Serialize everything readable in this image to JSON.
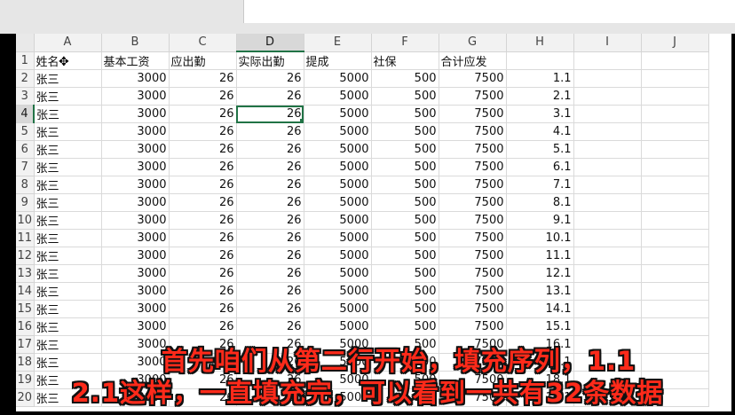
{
  "columns": [
    "A",
    "B",
    "C",
    "D",
    "E",
    "F",
    "G",
    "H",
    "I",
    "J"
  ],
  "selected_column": "D",
  "selected_row": "4",
  "header_row": {
    "row": "1",
    "cells": [
      "姓名",
      "基本工资",
      "应出勤",
      "实际出勤",
      "提成",
      "社保",
      "合计应发",
      "",
      "",
      ""
    ]
  },
  "data_rows": [
    {
      "row": "2",
      "cells": [
        "张三",
        "3000",
        "26",
        "26",
        "5000",
        "500",
        "7500",
        "1.1",
        "",
        ""
      ]
    },
    {
      "row": "3",
      "cells": [
        "张三",
        "3000",
        "26",
        "26",
        "5000",
        "500",
        "7500",
        "2.1",
        "",
        ""
      ]
    },
    {
      "row": "4",
      "cells": [
        "张三",
        "3000",
        "26",
        "26",
        "5000",
        "500",
        "7500",
        "3.1",
        "",
        ""
      ]
    },
    {
      "row": "5",
      "cells": [
        "张三",
        "3000",
        "26",
        "26",
        "5000",
        "500",
        "7500",
        "4.1",
        "",
        ""
      ]
    },
    {
      "row": "6",
      "cells": [
        "张三",
        "3000",
        "26",
        "26",
        "5000",
        "500",
        "7500",
        "5.1",
        "",
        ""
      ]
    },
    {
      "row": "7",
      "cells": [
        "张三",
        "3000",
        "26",
        "26",
        "5000",
        "500",
        "7500",
        "6.1",
        "",
        ""
      ]
    },
    {
      "row": "8",
      "cells": [
        "张三",
        "3000",
        "26",
        "26",
        "5000",
        "500",
        "7500",
        "7.1",
        "",
        ""
      ]
    },
    {
      "row": "9",
      "cells": [
        "张三",
        "3000",
        "26",
        "26",
        "5000",
        "500",
        "7500",
        "8.1",
        "",
        ""
      ]
    },
    {
      "row": "10",
      "cells": [
        "张三",
        "3000",
        "26",
        "26",
        "5000",
        "500",
        "7500",
        "9.1",
        "",
        ""
      ]
    },
    {
      "row": "11",
      "cells": [
        "张三",
        "3000",
        "26",
        "26",
        "5000",
        "500",
        "7500",
        "10.1",
        "",
        ""
      ]
    },
    {
      "row": "12",
      "cells": [
        "张三",
        "3000",
        "26",
        "26",
        "5000",
        "500",
        "7500",
        "11.1",
        "",
        ""
      ]
    },
    {
      "row": "13",
      "cells": [
        "张三",
        "3000",
        "26",
        "26",
        "5000",
        "500",
        "7500",
        "12.1",
        "",
        ""
      ]
    },
    {
      "row": "14",
      "cells": [
        "张三",
        "3000",
        "26",
        "26",
        "5000",
        "500",
        "7500",
        "13.1",
        "",
        ""
      ]
    },
    {
      "row": "15",
      "cells": [
        "张三",
        "3000",
        "26",
        "26",
        "5000",
        "500",
        "7500",
        "14.1",
        "",
        ""
      ]
    },
    {
      "row": "16",
      "cells": [
        "张三",
        "3000",
        "26",
        "26",
        "5000",
        "500",
        "7500",
        "15.1",
        "",
        ""
      ]
    },
    {
      "row": "17",
      "cells": [
        "张三",
        "3000",
        "26",
        "26",
        "5000",
        "500",
        "7500",
        "16.1",
        "",
        ""
      ]
    },
    {
      "row": "18",
      "cells": [
        "张三",
        "3000",
        "26",
        "26",
        "5000",
        "500",
        "7500",
        "17.1",
        "",
        ""
      ]
    },
    {
      "row": "19",
      "cells": [
        "张三",
        "3000",
        "26",
        "26",
        "5000",
        "500",
        "7500",
        "18.1",
        "",
        ""
      ]
    },
    {
      "row": "20",
      "cells": [
        "张三",
        "3000",
        "26",
        "26",
        "5000",
        "500",
        "7500",
        "19.1",
        "",
        ""
      ]
    }
  ],
  "active_cell": {
    "row": "4",
    "col": "D"
  },
  "caption": {
    "line1": "首先咱们从第二行开始，填充序列，1.1",
    "line2": "2.1这样，一直填充完，可以看到一共有32条数据"
  },
  "colors": {
    "accent": "#217346",
    "caption_text": "#ff2a1a"
  },
  "icons": [
    "move-cursor-icon"
  ]
}
